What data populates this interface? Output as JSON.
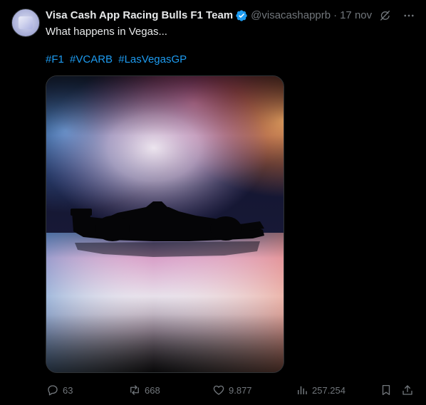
{
  "tweet": {
    "display_name": "Visa Cash App Racing Bulls F1 Team",
    "handle": "@visacashapprb",
    "separator": "·",
    "timestamp": "17 nov",
    "text": "What happens in Vegas...",
    "hashtags": [
      "#F1",
      "#VCARB",
      "#LasVegasGP"
    ],
    "media_description": "Silhouette of an F1 car against an iridescent backdrop"
  },
  "actions": {
    "replies": "63",
    "reposts": "668",
    "likes": "9.877",
    "views": "257.254"
  },
  "colors": {
    "background": "#000000",
    "text": "#e7e9ea",
    "muted": "#71767b",
    "accent": "#1d9bf0",
    "verified": "#1d9bf0"
  },
  "icons": {
    "verified": "verified-badge-icon",
    "grok": "grok-icon",
    "more": "more-icon",
    "reply": "reply-icon",
    "repost": "repost-icon",
    "like": "heart-icon",
    "views": "views-icon",
    "bookmark": "bookmark-icon",
    "share": "share-icon"
  }
}
